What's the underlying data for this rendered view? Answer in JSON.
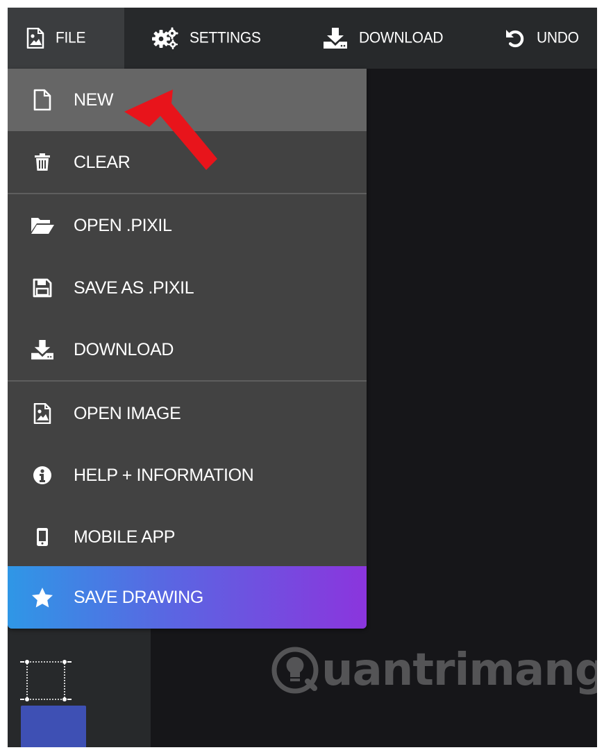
{
  "toolbar": {
    "file_label": "FILE",
    "settings_label": "SETTINGS",
    "download_label": "DOWNLOAD",
    "undo_label": "UNDO"
  },
  "file_menu": {
    "new_label": "NEW",
    "clear_label": "CLEAR",
    "open_pixil_label": "OPEN .PIXIL",
    "save_pixil_label": "SAVE AS .PIXIL",
    "download_label": "DOWNLOAD",
    "open_image_label": "OPEN IMAGE",
    "help_label": "HELP + INFORMATION",
    "mobile_label": "MOBILE APP",
    "save_drawing_label": "SAVE DRAWING"
  },
  "watermark": {
    "text": "uantrimang"
  },
  "icons": {
    "file": "image-file-icon",
    "settings": "gears-icon",
    "download": "download-icon",
    "undo": "undo-icon",
    "new": "blank-document-icon",
    "clear": "trash-icon",
    "open": "folder-open-icon",
    "save": "floppy-disk-icon",
    "open_image": "image-file-icon",
    "help": "info-icon",
    "mobile": "mobile-phone-icon",
    "save_drawing": "star-icon",
    "selection": "selection-tool-icon"
  },
  "colors": {
    "background": "#161619",
    "toolbar": "#27292b",
    "menu": "#424242",
    "menu_hover": "#666666",
    "gradient_start": "#2f97e6",
    "gradient_end": "#8b35dd",
    "swatch": "#3e50b4",
    "annotation_arrow": "#e8141b"
  }
}
